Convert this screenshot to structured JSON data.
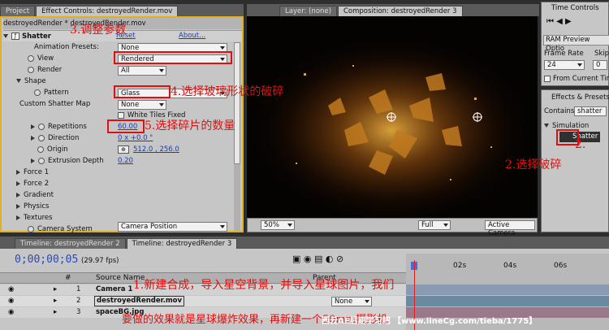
{
  "ec_tabs": [
    "Project",
    "Effect Controls: destroyedRender.mov"
  ],
  "ec_header": "destroyedRender * destroyedRender.mov",
  "effect": {
    "name": "Shatter",
    "reset": "Reset",
    "about": "About...",
    "presets_label": "Animation Presets:",
    "presets_value": "None"
  },
  "props": {
    "view": "View",
    "view_value": "Rendered",
    "render": "Render",
    "render_value": "All",
    "shape": "Shape",
    "pattern": "Pattern",
    "pattern_value": "Glass",
    "custom_map": "Custom Shatter Map",
    "custom_map_value": "None",
    "white_tiles": "White Tiles Fixed",
    "repetitions": "Repetitions",
    "repetitions_value": "60.00",
    "direction": "Direction",
    "direction_value": "0 x +0.0 °",
    "origin": "Origin",
    "origin_value": "512.0 , 256.0",
    "extrusion": "Extrusion Depth",
    "extrusion_value": "0.20",
    "force1": "Force 1",
    "force2": "Force 2",
    "gradient": "Gradient",
    "physics": "Physics",
    "textures": "Textures",
    "camera_system": "Camera System",
    "camera_system_value": "Camera Position"
  },
  "viewer_tabs": [
    "Layer: (none)",
    "Composition: destroyedRender 3"
  ],
  "viewer_bar": {
    "zoom": "50%",
    "quality": "Full",
    "camera": "Active Camera"
  },
  "tc_panel": {
    "title": "Time Controls",
    "ram": "RAM Preview Optio",
    "frame_rate": "Frame Rate",
    "skip": "Skip",
    "frame_rate_value": "24",
    "skip_value": "0",
    "from_current": "From Current Tim"
  },
  "ep_panel": {
    "title": "Effects & Presets",
    "contains": "Contains:",
    "contains_value": "shatter",
    "category": "Simulation",
    "item": "Shatter"
  },
  "timeline": {
    "tabs": [
      "Timeline: destroyedRender 2",
      "Timeline: destroyedRender 3"
    ],
    "timecode": "0;00;00;05",
    "fps": "(29.97 fps)",
    "col_num": "#",
    "col_source": "Source Name",
    "col_parent": "Parent",
    "ruler": [
      "02s",
      "04s",
      "06s"
    ],
    "layers": [
      {
        "num": "1",
        "name": "Camera 1",
        "parent": ""
      },
      {
        "num": "2",
        "name": "destroyedRender.mov",
        "parent": "None"
      },
      {
        "num": "3",
        "name": "spaceBG.jpg",
        "parent": ""
      }
    ]
  },
  "annotations": {
    "a3": "3.调整参数",
    "a4": "4.选择玻璃形状的破碎",
    "a5": "5.选择碎片的数量",
    "a2a": "2.",
    "a2b": "2.选择破碎",
    "a1": "1.新建合成，导入星空背景，并导入星球图片，我们",
    "a1b": "要做的效果就是星球爆炸效果，再新建一个50mm摄影机",
    "watermark": "西云AE后期学习吧 【www.lineCg.com/tieba/1775】"
  }
}
